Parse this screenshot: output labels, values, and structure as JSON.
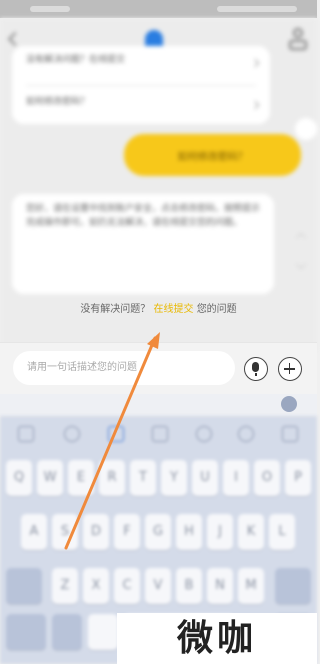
{
  "chat": {
    "question_card": {
      "row1": "没有解决问题？在线提交",
      "row2": "如何修改密码？"
    },
    "user_message": "如何修改密码？",
    "answer_text": "您好，请在设置中找到账户安全，点击修改密码，按照提示完成操作即可。如仍无法解决，请在线提交您的问题。"
  },
  "footer": {
    "prefix": "没有解决问题？",
    "link": "在线提交",
    "suffix": "您的问题"
  },
  "input": {
    "placeholder": "请用一句话描述您的问题"
  },
  "keyboard": {
    "row1": [
      "Q",
      "W",
      "E",
      "R",
      "T",
      "Y",
      "U",
      "I",
      "O",
      "P"
    ],
    "row2": [
      "A",
      "S",
      "D",
      "F",
      "G",
      "H",
      "J",
      "K",
      "L"
    ],
    "row3": [
      "Z",
      "X",
      "C",
      "V",
      "B",
      "N",
      "M"
    ]
  },
  "watermark": "微咖",
  "colors": {
    "accent_yellow": "#f7c81a",
    "link_yellow": "#e8b800",
    "arrow": "#f08a3c"
  }
}
